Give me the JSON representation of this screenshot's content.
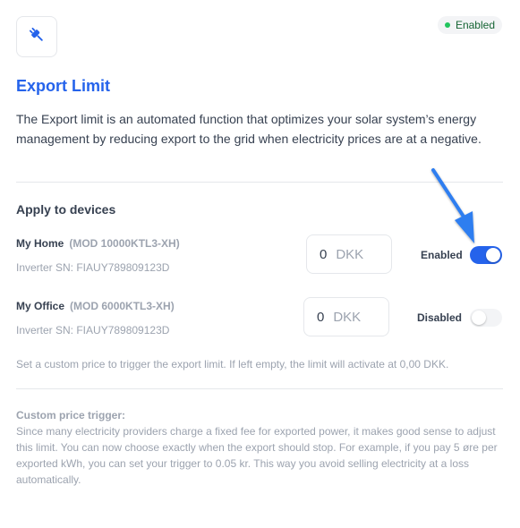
{
  "header": {
    "logo_icon": "plug-icon",
    "status_badge": "Enabled",
    "title": "Export Limit",
    "description": "The Export limit is an automated function that optimizes your solar system’s energy management by reducing export to the grid when electricity prices are at a negative."
  },
  "devices_section": {
    "title": "Apply to devices",
    "devices": [
      {
        "name": "My Home",
        "model": "(MOD 10000KTL3-XH)",
        "serial": "Inverter SN: FIAUY789809123D",
        "price_value": "0",
        "currency": "DKK",
        "status_label": "Enabled",
        "toggle_on": true
      },
      {
        "name": "My Office",
        "model": "(MOD 6000KTL3-XH)",
        "serial": "Inverter SN: FIAUY789809123D",
        "price_value": "0",
        "currency": "DKK",
        "status_label": "Disabled",
        "toggle_on": false
      }
    ],
    "hint": "Set a custom price to trigger the export limit. If left empty, the limit will activate at 0,00 DKK."
  },
  "custom_trigger": {
    "title": "Custom price trigger:",
    "text": "Since many electricity providers charge a fixed fee for exported power, it makes good sense to adjust this limit. You can now choose exactly when the export should stop. For example, if you pay 5 øre per exported kWh, you can set your trigger to 0.05 kr. This way you avoid selling electricity at a loss automatically."
  },
  "colors": {
    "accent": "#2563eb",
    "enabled_dot": "#22c55e"
  }
}
